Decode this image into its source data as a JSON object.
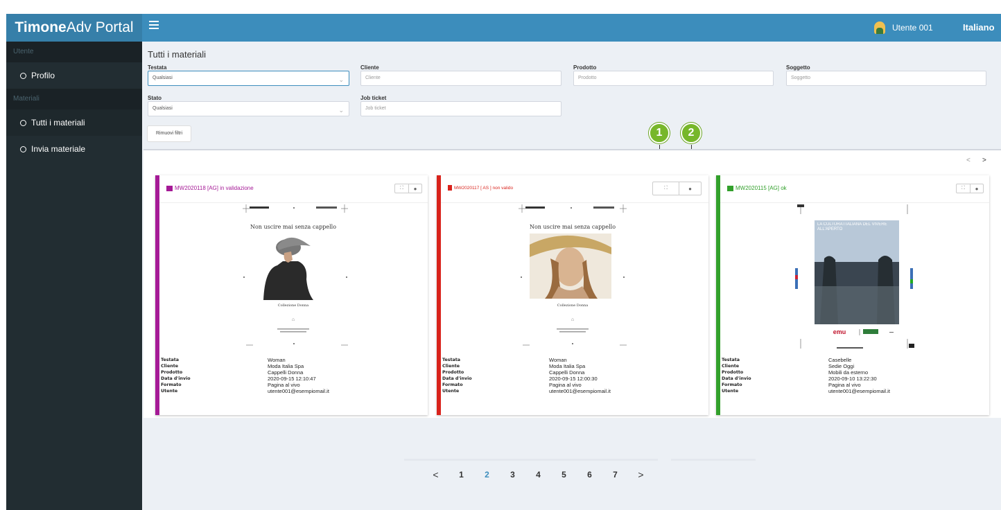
{
  "app": {
    "logo_bold": "Timone",
    "logo_rest": "Adv Portal",
    "user": "Utente 001",
    "language": "Italiano"
  },
  "colors": {
    "header": "#3c8dbc",
    "sidebar": "#222d32",
    "validation": "#a51a96",
    "invalid": "#d9231c",
    "ok": "#32a02b"
  },
  "sidebar": {
    "sections": [
      {
        "header": "Utente",
        "items": [
          {
            "label": "Profilo"
          }
        ]
      },
      {
        "header": "Materiali",
        "items": [
          {
            "label": "Tutti i materiali"
          },
          {
            "label": "Invia materiale"
          }
        ]
      }
    ]
  },
  "page": {
    "title": "Tutti i materiali"
  },
  "filters": {
    "testata": {
      "label": "Testata",
      "value": "Qualsiasi"
    },
    "cliente": {
      "label": "Cliente",
      "placeholder": "Cliente"
    },
    "prodotto": {
      "label": "Prodotto",
      "placeholder": "Prodotto"
    },
    "soggetto": {
      "label": "Soggetto",
      "placeholder": "Soggetto"
    },
    "stato": {
      "label": "Stato",
      "value": "Qualsiasi"
    },
    "job_ticket": {
      "label": "Job ticket",
      "placeholder": "Job ticket"
    },
    "reset": "Rimuovi filtri"
  },
  "callouts": [
    "1",
    "2"
  ],
  "carousel": {
    "prev": "<",
    "next": ">"
  },
  "meta_labels": [
    "Testata",
    "Cliente",
    "Prodotto",
    "Data d'invio",
    "Formato",
    "Utente"
  ],
  "cards": [
    {
      "title": "MW2020118 [AG] in validazione",
      "status_color": "#a51a96",
      "preview": {
        "headline": "Non uscire mai senza cappello",
        "caption": "Collezione Donna"
      },
      "values": [
        "Woman",
        "Moda Italia Spa",
        "Cappelli Donna",
        "2020-09-15 12:10:47",
        "Pagina al vivo",
        "utente001@esempiomail.it"
      ]
    },
    {
      "title": "MW2020117 [ AS ] non valido",
      "status_color": "#d9231c",
      "preview": {
        "headline": "Non uscire mai senza cappello",
        "caption": "Collezione Donna"
      },
      "values": [
        "Woman",
        "Moda Italia Spa",
        "Cappelli Donna",
        "2020-09-15 12:00:30",
        "Pagina al vivo",
        "utente001@esempiomail.it"
      ]
    },
    {
      "title": "MW2020115 [AG] ok",
      "status_color": "#32a02b",
      "preview": {
        "headline": "LA CULTURA ITALIANA DEL VIVERE ALL'APERTO",
        "brand": "emu"
      },
      "values": [
        "Casebelle",
        "Sedie Oggi",
        "Mobili da esterno",
        "2020-09-10 13:22:30",
        "Pagina al vivo",
        "utente001@esempiomail.it"
      ]
    }
  ],
  "pagination": {
    "prev": "<",
    "next": ">",
    "pages": [
      "1",
      "2",
      "3",
      "4",
      "5",
      "6",
      "7"
    ],
    "current": "2"
  }
}
